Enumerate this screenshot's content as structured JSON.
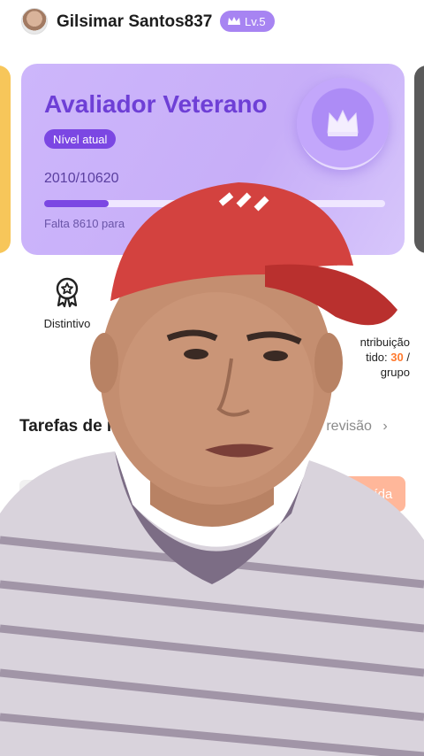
{
  "header": {
    "username": "Gilsimar Santos837",
    "level_badge": "Lv.5"
  },
  "level_card": {
    "title": "Avaliador Veterano",
    "current_level_label": "Nível atual",
    "progress_text": "2010/10620",
    "progress_fraction": 0.189,
    "remaining_text": "Falta 8610 para"
  },
  "features": {
    "badge_label": "Distintivo",
    "contribution_line1": "ntribuição",
    "contribution_line2_prefix": "tido:",
    "contribution_value": "30",
    "contribution_line2_suffix": "/",
    "contribution_line3": "grupo"
  },
  "tasks": {
    "title": "Tarefas de re",
    "review_link": "e revisão",
    "chevron": "›",
    "task_label": "T",
    "done_button": "Concluída"
  },
  "colors": {
    "accent": "#7b47e3",
    "card_bg": "#c7aef8",
    "orange_value": "#ff7a2f",
    "done_button": "#ffb79a"
  }
}
